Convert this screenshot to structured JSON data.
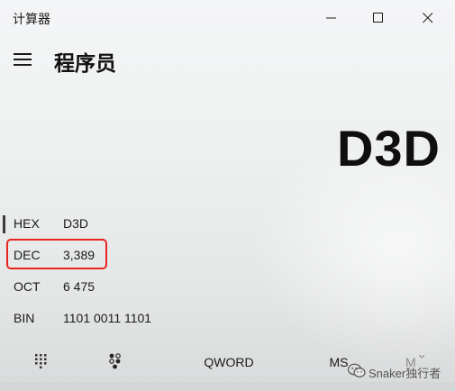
{
  "window": {
    "title": "计算器",
    "controls": {
      "minimize_icon": "minimize-icon",
      "maximize_icon": "maximize-icon",
      "close_icon": "close-icon"
    }
  },
  "header": {
    "menu_icon": "hamburger-menu-icon",
    "mode_title": "程序员"
  },
  "display": {
    "value": "D3D"
  },
  "radix": [
    {
      "label": "HEX",
      "value": "D3D",
      "active": true
    },
    {
      "label": "DEC",
      "value": "3,389",
      "highlighted": true
    },
    {
      "label": "OCT",
      "value": "6 475"
    },
    {
      "label": "BIN",
      "value": "1101 0011 1101"
    }
  ],
  "bottom_bar": {
    "keypad_icon": "full-keypad-icon",
    "bitflip_icon": "bit-toggling-keypad-icon",
    "word_size": "QWORD",
    "memory_store": "MS",
    "memory_dropdown": "M"
  },
  "watermark": {
    "text": "Snaker独行者",
    "icon": "wechat-icon"
  },
  "colors": {
    "highlight_box": "#e8251f",
    "text": "#111111",
    "background": "#eef0f0"
  }
}
